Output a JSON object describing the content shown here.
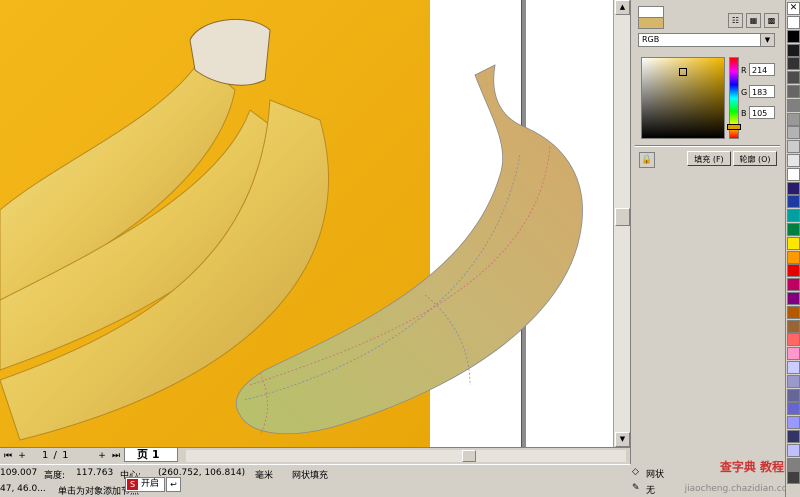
{
  "page_nav": {
    "first": "⏮",
    "add": "+",
    "indicator": "1 / 1",
    "add2": "+",
    "last": "⏭",
    "tab_label": "页 1"
  },
  "statusbar": {
    "coord_left": "109.007",
    "height_label": "高度:",
    "height_value": "117.763",
    "center_label": "中心:",
    "center_value": "(260.752, 106.814)",
    "unit": "毫米",
    "object_type": "网状填充",
    "line2_left": "47, 46.0...",
    "line2_hint": "单击为对象添加节点",
    "task_label": "开启",
    "task_icon": "S",
    "task_box": "↩"
  },
  "panel": {
    "color_model": "RGB",
    "channels": [
      {
        "label": "R",
        "value": "214"
      },
      {
        "label": "G",
        "value": "183"
      },
      {
        "label": "B",
        "value": "105"
      }
    ],
    "fill_button": "填充 (F)",
    "outline_button": "轮廓 (O)",
    "swatch_new_color": "#d6b769"
  },
  "outline_status": {
    "mesh_label": "网状",
    "none_label": "无"
  },
  "watermark": {
    "line1": "查字典 教程网",
    "line2": "jiaocheng.chazidian.com"
  },
  "palette_colors": [
    "#ffffff",
    "#000000",
    "#1a1a1a",
    "#333333",
    "#4d4d4d",
    "#666666",
    "#808080",
    "#999999",
    "#b3b3b3",
    "#cccccc",
    "#e6e6e6",
    "#ffffff",
    "#2b1b6b",
    "#1e3ca0",
    "#00a0a0",
    "#008040",
    "#ffe600",
    "#ff9900",
    "#e60000",
    "#c00060",
    "#800080",
    "#b35900",
    "#996633",
    "#ff6666",
    "#ff99cc",
    "#ccccff",
    "#9999cc",
    "#666699",
    "#6666cc",
    "#9999ff",
    "#333366",
    "#c0c0ff",
    "#808080",
    "#404040"
  ]
}
